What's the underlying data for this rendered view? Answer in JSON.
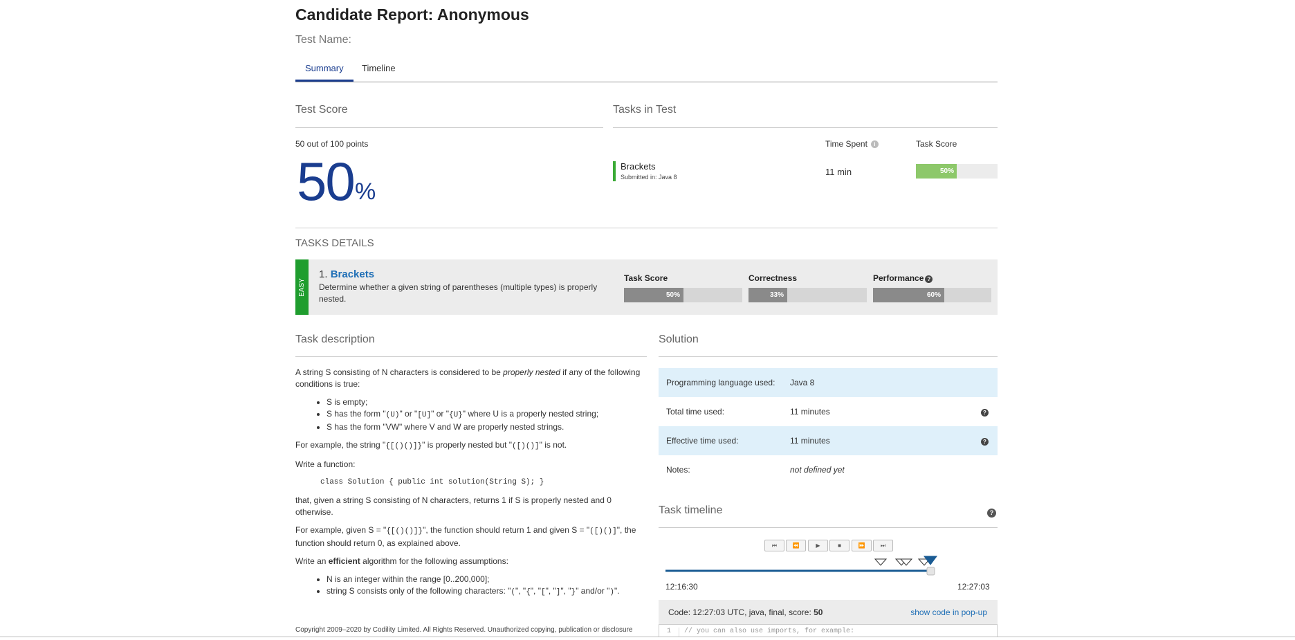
{
  "header": {
    "title": "Candidate Report: Anonymous",
    "test_name_label": "Test Name:"
  },
  "tabs": [
    {
      "label": "Summary",
      "active": true
    },
    {
      "label": "Timeline",
      "active": false
    }
  ],
  "test_score": {
    "heading": "Test Score",
    "points_text": "50 out of 100 points",
    "percent": "50",
    "percent_sign": "%"
  },
  "tasks_in_test": {
    "heading": "Tasks in Test",
    "col_time": "Time Spent",
    "col_score": "Task Score",
    "tasks": [
      {
        "name": "Brackets",
        "submitted": "Submitted in: Java 8",
        "time": "11 min",
        "score_label": "50%",
        "score_fraction": 0.5
      }
    ]
  },
  "task_details": {
    "heading": "TASKS DETAILS",
    "difficulty": "EASY",
    "number": "1.",
    "name": "Brackets",
    "description": "Determine whether a given string of parentheses (multiple types) is properly nested.",
    "metrics": [
      {
        "label": "Task Score",
        "value_label": "50%",
        "fraction": 0.5
      },
      {
        "label": "Correctness",
        "value_label": "33%",
        "fraction": 0.33
      },
      {
        "label": "Performance",
        "value_label": "60%",
        "fraction": 0.6
      }
    ]
  },
  "task_description": {
    "heading": "Task description",
    "p1_a": "A string S consisting of N characters is considered to be ",
    "p1_em": "properly nested",
    "p1_b": " if any of the following conditions is true:",
    "cond1": "S is empty;",
    "cond2_a": "S has the form \"",
    "cond2_c1": "(U)",
    "cond2_b": "\" or \"",
    "cond2_c2": "[U]",
    "cond2_c": "\" or \"",
    "cond2_c3": "{U}",
    "cond2_d": "\" where U is a properly nested string;",
    "cond3": "S has the form \"VW\" where V and W are properly nested strings.",
    "ex_a": "For example, the string \"",
    "ex_c1": "{[()()]}",
    "ex_b": "\" is properly nested but \"",
    "ex_c2": "([)()]",
    "ex_c": "\" is not.",
    "write_fn": "Write a function:",
    "signature": "class Solution { public int solution(String S); }",
    "returns": "that, given a string S consisting of N characters, returns 1 if S is properly nested and 0 otherwise.",
    "ex2_a": "For example, given S = \"",
    "ex2_c1": "{[()()]}",
    "ex2_b": "\", the function should return 1 and given S = \"",
    "ex2_c2": "([)()]",
    "ex2_c": "\", the function should return 0, as explained above.",
    "efficient_a": "Write an ",
    "efficient_b": "efficient",
    "efficient_c": " algorithm for the following assumptions:",
    "assume1": "N is an integer within the range [0..200,000];",
    "assume2_a": "string S consists only of the following characters: \"",
    "assume2_c1": "(",
    "assume2_b": "\", \"",
    "assume2_c2": "{",
    "assume2_c": "\", \"",
    "assume2_c3": "[",
    "assume2_d": "\", \"",
    "assume2_c4": "]",
    "assume2_e": "\", \"",
    "assume2_c5": "}",
    "assume2_f": "\" and/or \"",
    "assume2_c6": ")",
    "assume2_g": "\".",
    "copyright": "Copyright 2009–2020 by Codility Limited. All Rights Reserved. Unauthorized copying, publication or disclosure"
  },
  "solution": {
    "heading": "Solution",
    "rows": [
      {
        "key": "Programming language used:",
        "value": "Java 8"
      },
      {
        "key": "Total time used:",
        "value": "11 minutes"
      },
      {
        "key": "Effective time used:",
        "value": "11 minutes"
      },
      {
        "key": "Notes:",
        "value": "not defined yet"
      }
    ]
  },
  "timeline": {
    "heading": "Task timeline",
    "start_time": "12:16:30",
    "end_time": "12:27:03",
    "controls": [
      "⏮",
      "⏪",
      "▶",
      "■",
      "⏩",
      "⏭"
    ]
  },
  "code": {
    "label": "Code: 12:27:03 UTC, java, final, score: ",
    "score": "50",
    "popup_link": "show code in pop-up",
    "line_no": "1",
    "line_text": "// you can also use imports, for example:"
  },
  "colors": {
    "accent_blue": "#1a3d8f",
    "link_blue": "#1f6fb6",
    "green": "#3aaa35",
    "easy_green": "#1f9d2e",
    "score_green": "#8dc86a",
    "bar_grey": "#8a8a8a",
    "row_blue": "#dff0fa"
  }
}
